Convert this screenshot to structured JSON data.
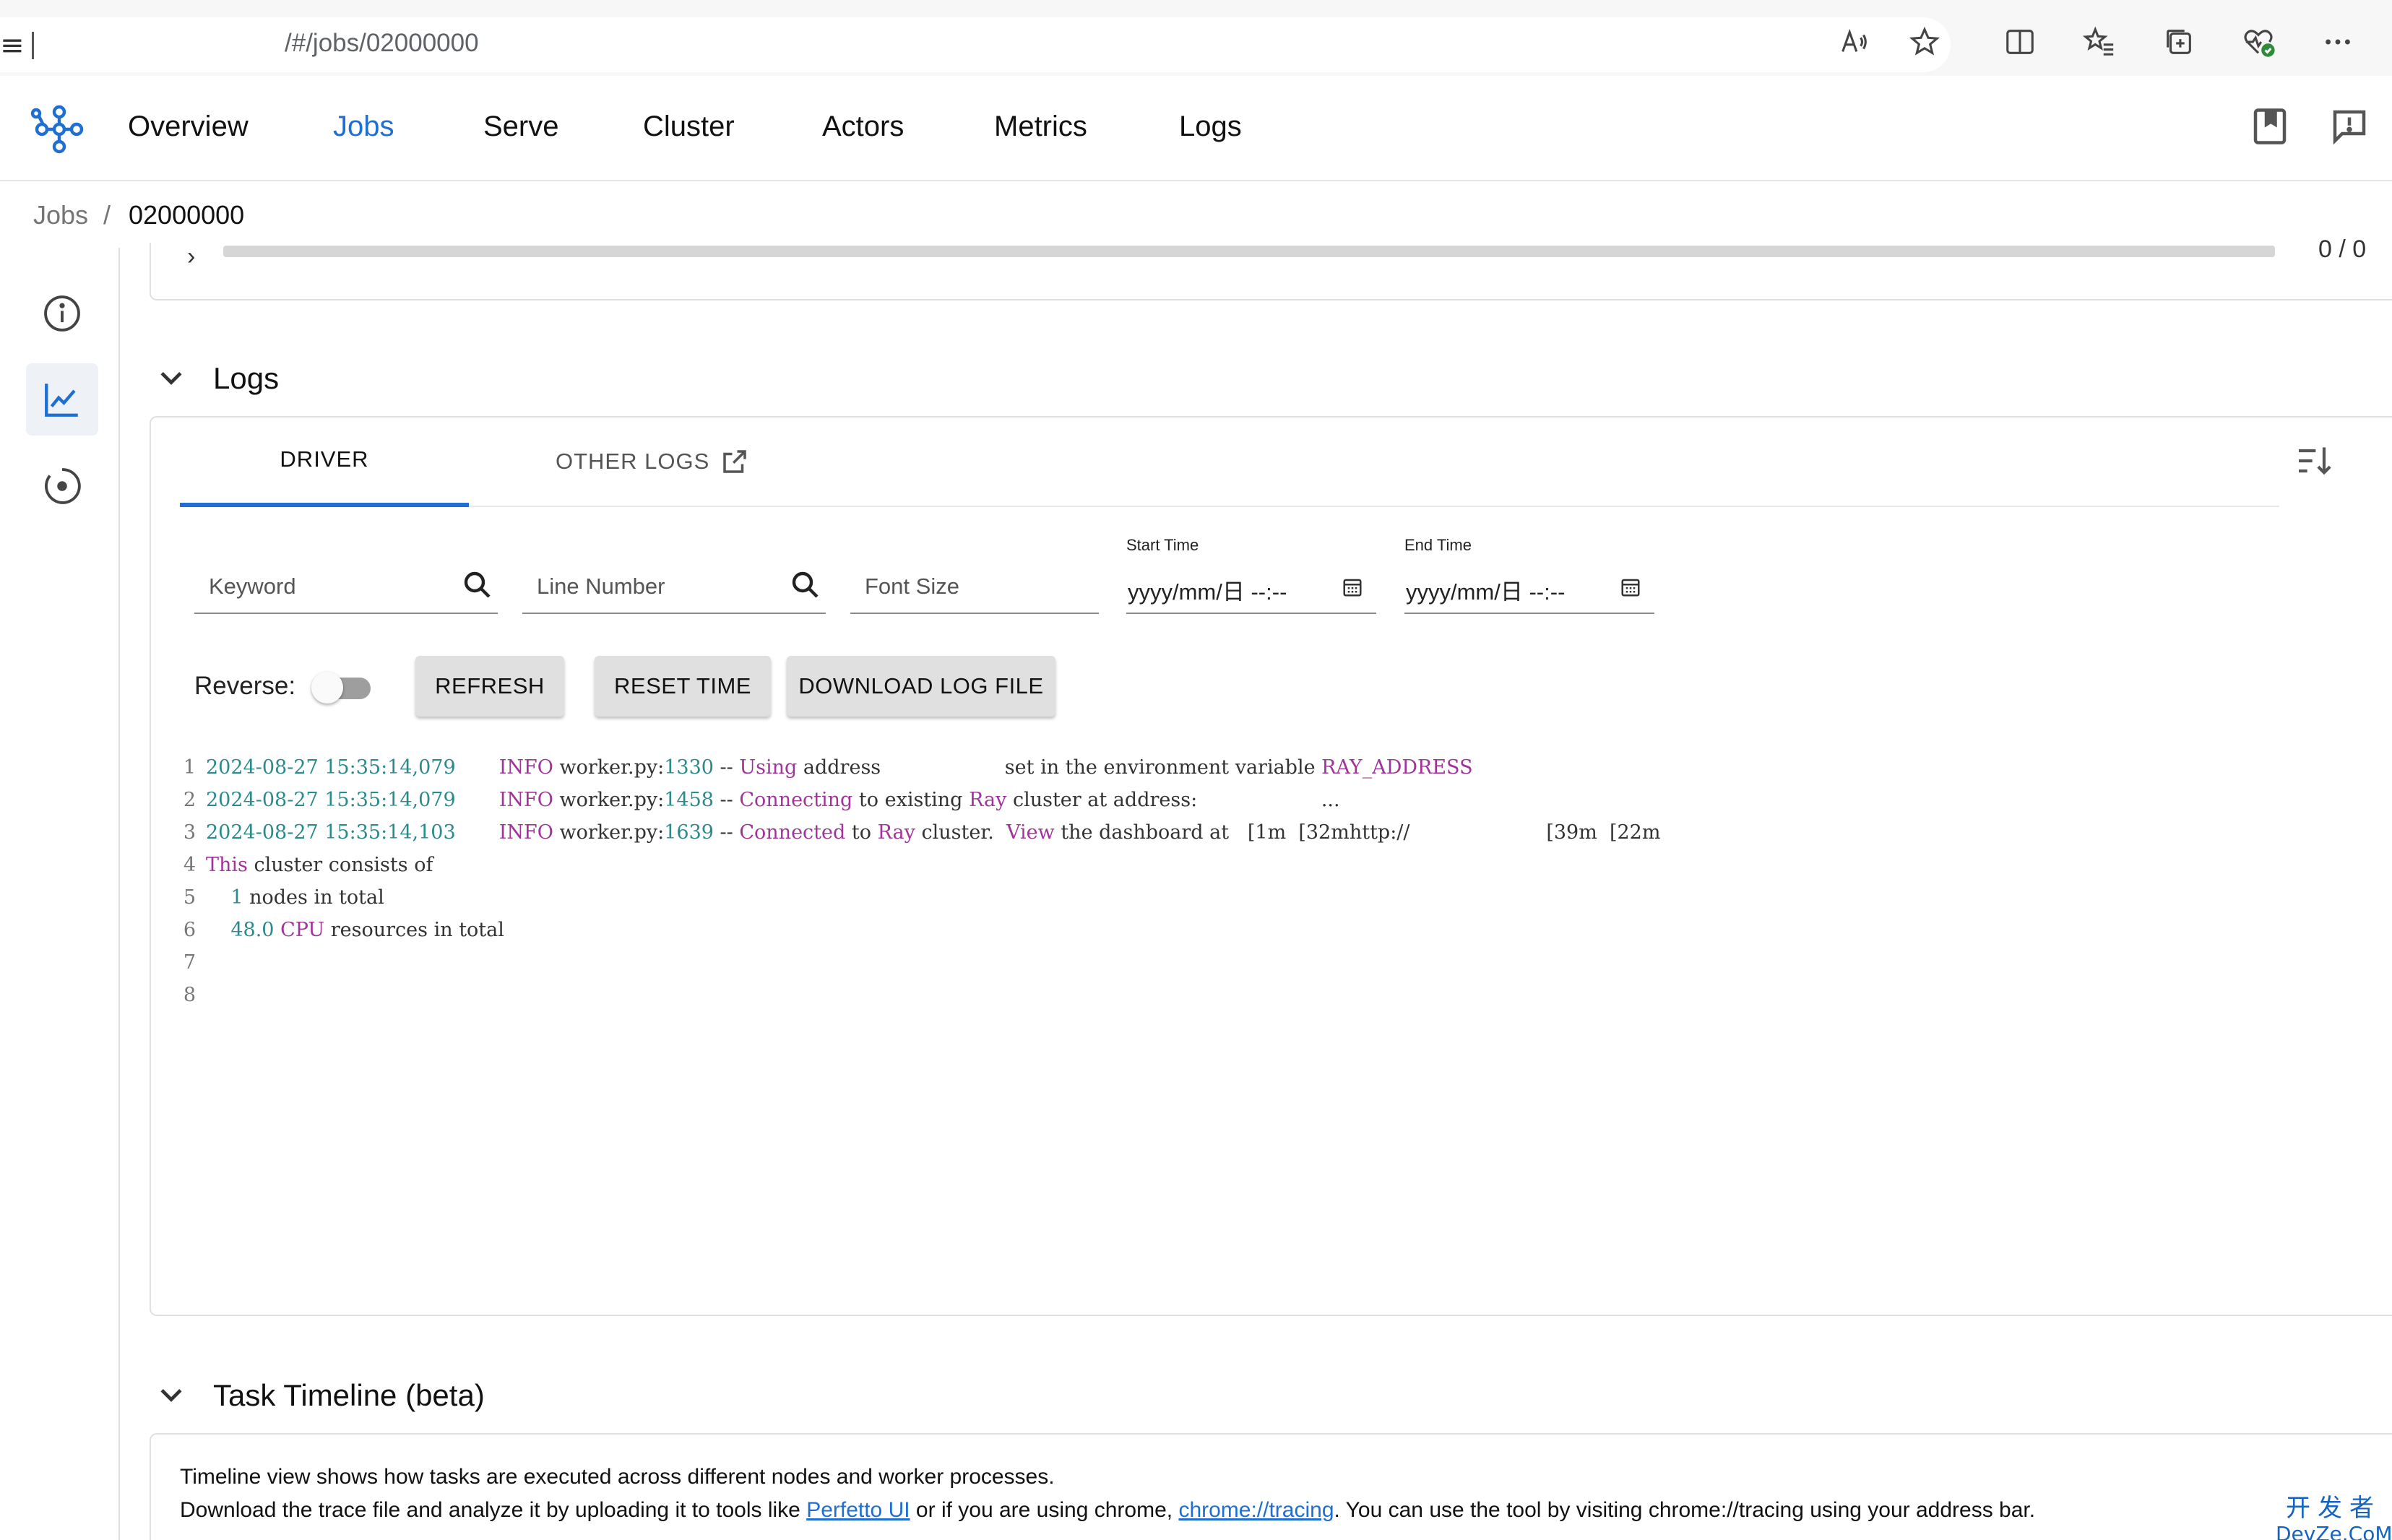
{
  "browser": {
    "url": "/#/jobs/02000000"
  },
  "nav": {
    "items": [
      "Overview",
      "Jobs",
      "Serve",
      "Cluster",
      "Actors",
      "Metrics",
      "Logs"
    ],
    "active": "Jobs"
  },
  "breadcrumb": {
    "root": "Jobs",
    "separator": "/",
    "current": "02000000"
  },
  "progress": {
    "count": "0 / 0"
  },
  "logs_section": {
    "title": "Logs",
    "tabs": {
      "driver": "DRIVER",
      "other": "OTHER LOGS"
    },
    "filters": {
      "keyword_placeholder": "Keyword",
      "line_number_placeholder": "Line Number",
      "font_size_placeholder": "Font Size",
      "start_time_label": "Start Time",
      "start_time_value": "yyyy/mm/日 --:--",
      "end_time_label": "End Time",
      "end_time_value": "yyyy/mm/日 --:--"
    },
    "controls": {
      "reverse_label": "Reverse:",
      "refresh": "REFRESH",
      "reset_time": "RESET TIME",
      "download": "DOWNLOAD LOG FILE"
    },
    "lines": [
      {
        "n": "1",
        "parts": [
          [
            "num",
            "2024-08-27 15:35:14,079"
          ],
          [
            "plain",
            "       "
          ],
          [
            "kw",
            "INFO"
          ],
          [
            "plain",
            " worker.py:"
          ],
          [
            "num",
            "1330"
          ],
          [
            "plain",
            " -- "
          ],
          [
            "kw",
            "Using"
          ],
          [
            "plain",
            " address                    set in the environment variable "
          ],
          [
            "kw",
            "RAY_ADDRESS"
          ]
        ]
      },
      {
        "n": "2",
        "parts": [
          [
            "num",
            "2024-08-27 15:35:14,079"
          ],
          [
            "plain",
            "       "
          ],
          [
            "kw",
            "INFO"
          ],
          [
            "plain",
            " worker.py:"
          ],
          [
            "num",
            "1458"
          ],
          [
            "plain",
            " -- "
          ],
          [
            "kw",
            "Connecting"
          ],
          [
            "plain",
            " to existing "
          ],
          [
            "kw",
            "Ray"
          ],
          [
            "plain",
            " cluster at address:                    ..."
          ]
        ]
      },
      {
        "n": "3",
        "parts": [
          [
            "num",
            "2024-08-27 15:35:14,103"
          ],
          [
            "plain",
            "       "
          ],
          [
            "kw",
            "INFO"
          ],
          [
            "plain",
            " worker.py:"
          ],
          [
            "num",
            "1639"
          ],
          [
            "plain",
            " -- "
          ],
          [
            "kw",
            "Connected"
          ],
          [
            "plain",
            " to "
          ],
          [
            "kw",
            "Ray"
          ],
          [
            "plain",
            " cluster.  "
          ],
          [
            "kw",
            "View"
          ],
          [
            "plain",
            " the dashboard at   [1m  [32mhttp://                      [39m  [22m"
          ]
        ]
      },
      {
        "n": "4",
        "parts": [
          [
            "kw",
            "This"
          ],
          [
            "plain",
            " cluster consists of"
          ]
        ]
      },
      {
        "n": "5",
        "parts": [
          [
            "plain",
            "    "
          ],
          [
            "num",
            "1"
          ],
          [
            "plain",
            " nodes in total"
          ]
        ]
      },
      {
        "n": "6",
        "parts": [
          [
            "plain",
            "    "
          ],
          [
            "num",
            "48.0"
          ],
          [
            "plain",
            " "
          ],
          [
            "kw",
            "CPU"
          ],
          [
            "plain",
            " resources in total"
          ]
        ]
      },
      {
        "n": "7",
        "parts": []
      },
      {
        "n": "8",
        "parts": []
      }
    ]
  },
  "timeline_section": {
    "title": "Task Timeline (beta)",
    "line1": "Timeline view shows how tasks are executed across different nodes and worker processes.",
    "line2_a": "Download the trace file and analyze it by uploading it to tools like ",
    "line2_link1": "Perfetto UI",
    "line2_b": " or if you are using chrome, ",
    "line2_link2": "chrome://tracing",
    "line2_c": ". You can use the tool by visiting chrome://tracing using your address bar."
  },
  "watermark": {
    "cn": "开发者",
    "en": "DevZe.CoM"
  },
  "colors": {
    "accent": "#1e6fd1",
    "log_number": "#2b8a8a",
    "log_keyword": "#a0349b"
  }
}
